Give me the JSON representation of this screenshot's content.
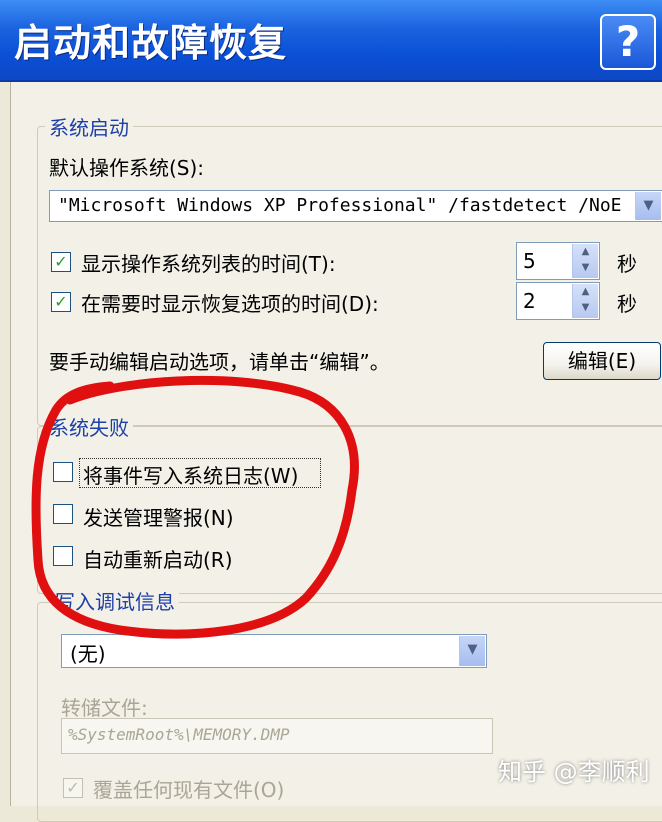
{
  "window": {
    "title": "启动和故障恢复",
    "help_label": "?"
  },
  "startup": {
    "group_label": "系统启动",
    "default_os_label": "默认操作系统(S):",
    "default_os_value": "\"Microsoft Windows XP Professional\" /fastdetect /NoE",
    "show_list": {
      "checked": true,
      "label": "显示操作系统列表的时间(T):",
      "value": "5",
      "unit": "秒"
    },
    "show_recovery": {
      "checked": true,
      "label": "在需要时显示恢复选项的时间(D):",
      "value": "2",
      "unit": "秒"
    },
    "manual_edit_text": "要手动编辑启动选项，请单击“编辑”。",
    "edit_button": "编辑(E)"
  },
  "failure": {
    "group_label": "系统失败",
    "write_event": {
      "checked": false,
      "label": "将事件写入系统日志(W)"
    },
    "send_alert": {
      "checked": false,
      "label": "发送管理警报(N)"
    },
    "auto_restart": {
      "checked": false,
      "label": "自动重新启动(R)"
    }
  },
  "debug": {
    "group_label": "写入调试信息",
    "select_value": "(无)",
    "dump_label": "转储文件:",
    "dump_value": "%SystemRoot%\\MEMORY.DMP",
    "overwrite": {
      "checked": true,
      "label": "覆盖任何现有文件(O)"
    }
  },
  "watermark": "知乎 @李顺利",
  "annotation_color": "#e01010"
}
